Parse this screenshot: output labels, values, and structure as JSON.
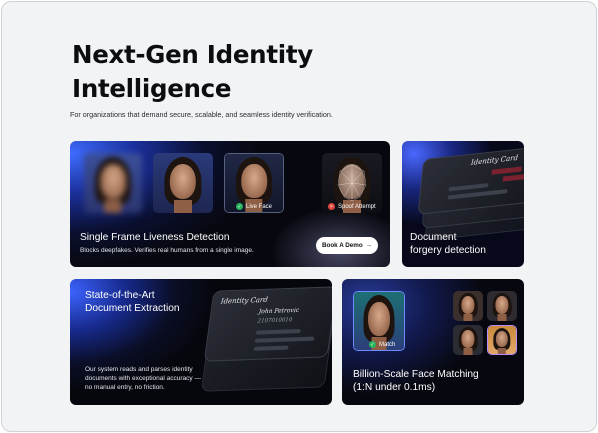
{
  "hero": {
    "title_line1": "Next-Gen Identity",
    "title_line2": "Intelligence",
    "subtitle": "For organizations that demand secure, scalable, and seamless identity verification."
  },
  "cards": {
    "liveness": {
      "title": "Single Frame Liveness Detection",
      "description": "Blocks deepfakes. Verifies real humans from a single image.",
      "live_label": "Live Face",
      "spoof_label": "Spoof Attempt",
      "button_label": "Book A Demo",
      "button_arrow": "→"
    },
    "forgery": {
      "title_line1": "Document",
      "title_line2": "forgery detection",
      "card_label": "Identity Card"
    },
    "extraction": {
      "title_line1": "State-of-the-Art",
      "title_line2": "Document Extraction",
      "description": "Our system reads and parses identity documents with exceptional accuracy —no manual entry, no friction.",
      "card_label": "Identity Card",
      "card_name": "John Petrovic",
      "card_number": "2107010010"
    },
    "matching": {
      "title_line1": "Billion-Scale Face Matching",
      "title_line2": "(1:N under 0.1ms)",
      "match_label": "Match"
    }
  },
  "colors": {
    "page_bg": "#f2f3f5",
    "accent_blue": "#3f6cff",
    "success": "#29b45c",
    "danger": "#e0473f"
  }
}
